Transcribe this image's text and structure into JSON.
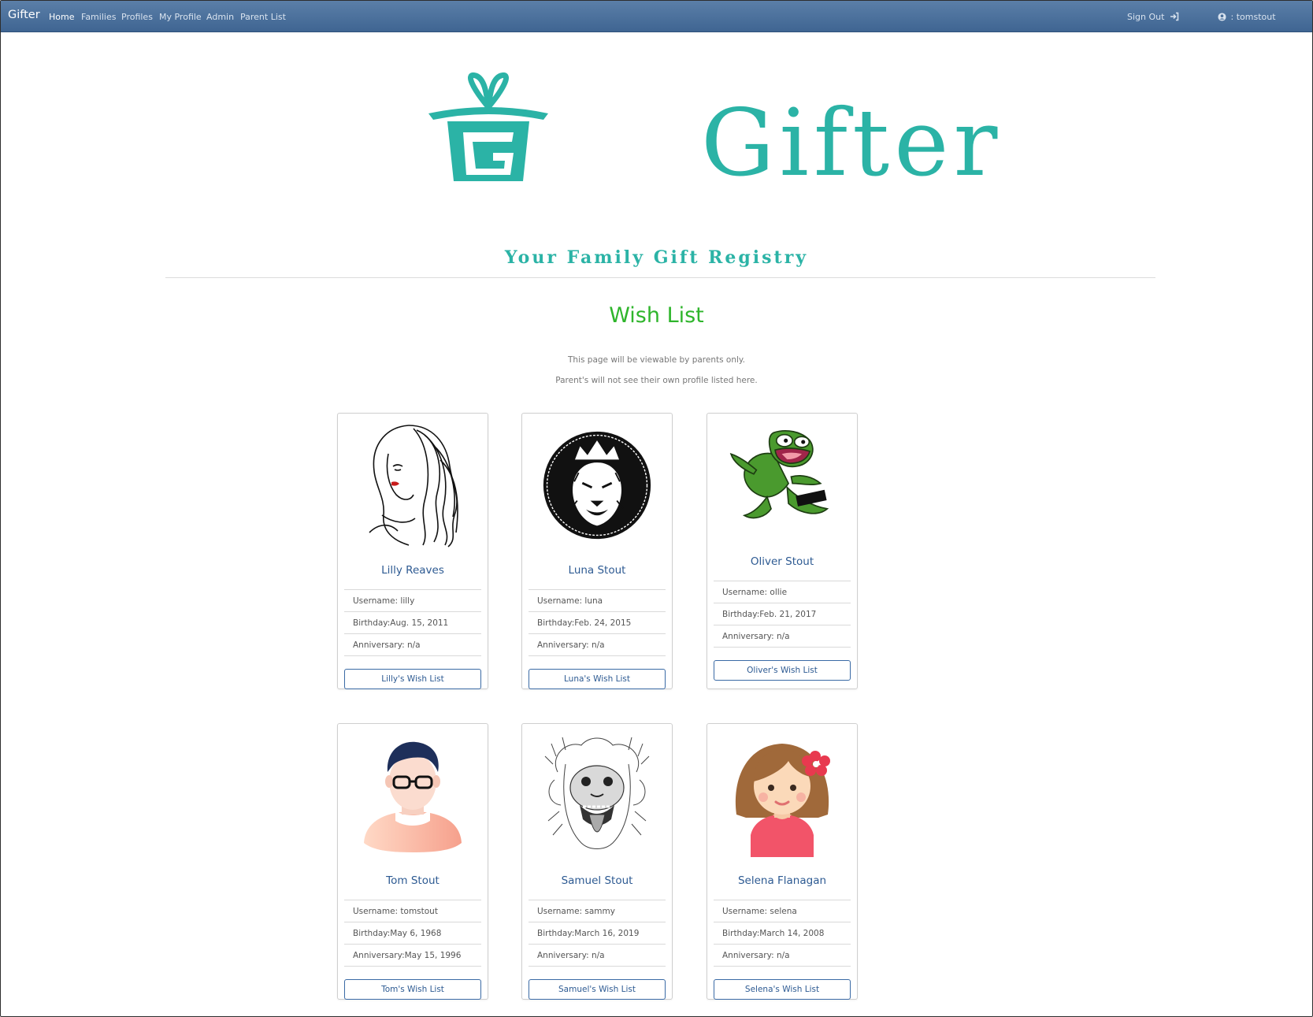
{
  "nav": {
    "brand": "Gifter",
    "links": [
      "Home",
      "Families",
      "Profiles",
      "My Profile",
      "Admin",
      "Parent List"
    ],
    "signout": "Sign Out",
    "user": ": tomstout"
  },
  "hero": {
    "logo_text": "Gifter",
    "tagline": "Your Family Gift Registry"
  },
  "main": {
    "title": "Wish List",
    "notes": [
      "This page will be viewable by parents only.",
      "Parent's will not see their own profile listed here."
    ]
  },
  "colors": {
    "brand_teal": "#2bb3a6",
    "title_green": "#2fb52c",
    "nav_blue": "#3f6592",
    "link_blue": "#2d5a92"
  },
  "profiles": [
    {
      "name": "Lilly Reaves",
      "username": "Username: lilly",
      "birthday": "Birthday:Aug. 15, 2011",
      "anniversary": "Anniversary: n/a",
      "button": "Lilly's Wish List",
      "avatar": "woman-sketch-avatar"
    },
    {
      "name": "Luna Stout",
      "username": "Username: luna",
      "birthday": "Birthday:Feb. 24, 2015",
      "anniversary": "Anniversary: n/a",
      "button": "Luna's Wish List",
      "avatar": "lion-crown-avatar"
    },
    {
      "name": "Oliver Stout",
      "username": "Username: ollie",
      "birthday": "Birthday:Feb. 21, 2017",
      "anniversary": "Anniversary: n/a",
      "button": "Oliver's Wish List",
      "avatar": "frog-avatar"
    },
    {
      "name": "Tom Stout",
      "username": "Username: tomstout",
      "birthday": "Birthday:May 6, 1968",
      "anniversary": "Anniversary:May 15, 1996",
      "button": "Tom's Wish List",
      "avatar": "man-glasses-avatar"
    },
    {
      "name": "Samuel Stout",
      "username": "Username: sammy",
      "birthday": "Birthday:March 16, 2019",
      "anniversary": "Anniversary: n/a",
      "button": "Samuel's Wish List",
      "avatar": "monkey-sketch-avatar"
    },
    {
      "name": "Selena Flanagan",
      "username": "Username: selena",
      "birthday": "Birthday:March 14, 2008",
      "anniversary": "Anniversary: n/a",
      "button": "Selena's Wish List",
      "avatar": "girl-flower-avatar"
    }
  ]
}
